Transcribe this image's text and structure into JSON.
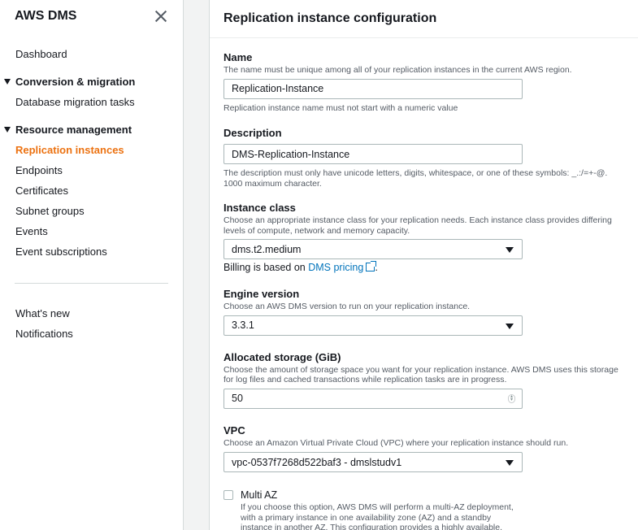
{
  "sidebar": {
    "title": "AWS DMS",
    "dashboard": "Dashboard",
    "section1": "Conversion & migration",
    "section1_items": [
      "Database migration tasks"
    ],
    "section2": "Resource management",
    "section2_items": [
      "Replication instances",
      "Endpoints",
      "Certificates",
      "Subnet groups",
      "Events",
      "Event subscriptions"
    ],
    "active_item": "Replication instances",
    "whats_new": "What's new",
    "notifications": "Notifications"
  },
  "panel": {
    "title": "Replication instance configuration"
  },
  "fields": {
    "name": {
      "label": "Name",
      "description": "The name must be unique among all of your replication instances in the current AWS region.",
      "value": "Replication-Instance",
      "hint": "Replication instance name must not start with a numeric value"
    },
    "description": {
      "label": "Description",
      "value": "DMS-Replication-Instance",
      "hint": "The description must only have unicode letters, digits, whitespace, or one of these symbols: _.:/=+-@. 1000 maximum character."
    },
    "instance_class": {
      "label": "Instance class",
      "description": "Choose an appropriate instance class for your replication needs. Each instance class provides differing levels of compute, network and memory capacity.",
      "value": "dms.t2.medium",
      "billing_prefix": "Billing is based on ",
      "billing_link": "DMS pricing",
      "billing_suffix": "."
    },
    "engine_version": {
      "label": "Engine version",
      "description": "Choose an AWS DMS version to run on your replication instance.",
      "value": "3.3.1"
    },
    "storage": {
      "label": "Allocated storage (GiB)",
      "description": "Choose the amount of storage space you want for your replication instance. AWS DMS uses this storage for log files and cached transactions while replication tasks are in progress.",
      "value": "50"
    },
    "vpc": {
      "label": "VPC",
      "description": "Choose an Amazon Virtual Private Cloud (VPC) where your replication instance should run.",
      "value": "vpc-0537f7268d522baf3 - dmslstudv1"
    },
    "multi_az": {
      "label": "Multi AZ",
      "checked": false,
      "description": "If you choose this option, AWS DMS will perform a multi-AZ deployment, with a primary instance in one availability zone (AZ) and a standby instance in another AZ. This configuration provides a highly available, fault-tolerant replication environment."
    }
  },
  "colors": {
    "accent": "#ec7211",
    "link": "#0073bb",
    "text": "#16191f",
    "muted": "#545b64"
  }
}
